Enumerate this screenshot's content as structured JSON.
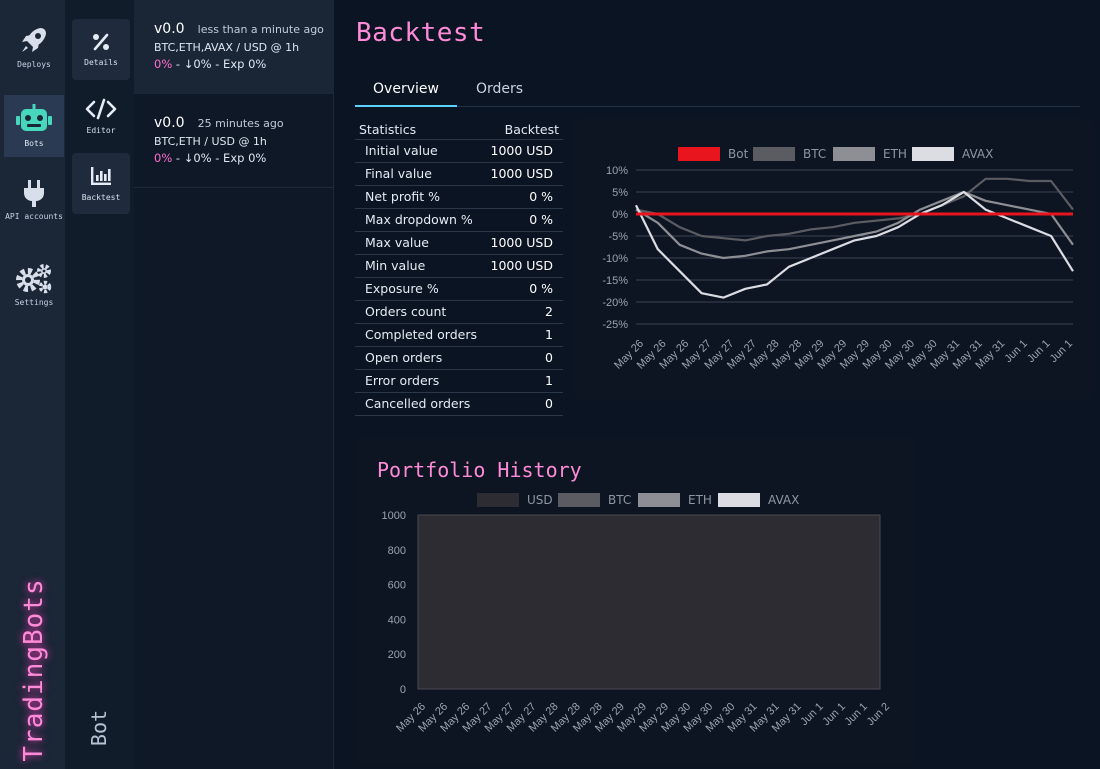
{
  "nav": {
    "items": [
      {
        "label": "Deploys",
        "icon": "rocket-icon"
      },
      {
        "label": "Bots",
        "icon": "robot-icon"
      },
      {
        "label": "API accounts",
        "icon": "plug-icon"
      },
      {
        "label": "Settings",
        "icon": "gears-icon"
      }
    ],
    "brand": "TradingBots"
  },
  "subnav": {
    "items": [
      {
        "label": "Details",
        "icon": "percent-icon"
      },
      {
        "label": "Editor",
        "icon": "code-icon"
      },
      {
        "label": "Backtest",
        "icon": "bar-chart-icon"
      }
    ],
    "section": "Bot"
  },
  "bots": [
    {
      "version": "v0.0",
      "time": "less than a minute ago",
      "pair": "BTC,ETH,AVAX / USD @ 1h",
      "profit": "0%",
      "rest": " - ↓0% - Exp 0%"
    },
    {
      "version": "v0.0",
      "time": "25 minutes ago",
      "pair": "BTC,ETH / USD @ 1h",
      "profit": "0%",
      "rest": " - ↓0% - Exp 0%"
    }
  ],
  "page": {
    "title": "Backtest",
    "tabs": [
      "Overview",
      "Orders"
    ]
  },
  "stats": {
    "headers": [
      "Statistics",
      "Backtest"
    ],
    "rows": [
      {
        "label": "Initial value",
        "value": "1000 USD"
      },
      {
        "label": "Final value",
        "value": "1000 USD"
      },
      {
        "label": "Net profit %",
        "value": "0 %"
      },
      {
        "label": "Max dropdown %",
        "value": "0 %"
      },
      {
        "label": "Max value",
        "value": "1000 USD"
      },
      {
        "label": "Min value",
        "value": "1000 USD"
      },
      {
        "label": "Exposure %",
        "value": "0 %"
      },
      {
        "label": "Orders count",
        "value": "2"
      },
      {
        "label": "Completed orders",
        "value": "1"
      },
      {
        "label": "Open orders",
        "value": "0"
      },
      {
        "label": "Error orders",
        "value": "1"
      },
      {
        "label": "Cancelled orders",
        "value": "0"
      }
    ]
  },
  "colors": {
    "accent": "#ff8ad8",
    "bot": "#e8141e",
    "btc": "#5b5c61",
    "eth": "#8e8f94",
    "avax": "#dcdde2",
    "usd": "#2e2c33"
  },
  "chart_data": [
    {
      "type": "line",
      "legend": [
        "Bot",
        "BTC",
        "ETH",
        "AVAX"
      ],
      "yticks": [
        "10%",
        "5%",
        "0%",
        "-5%",
        "-10%",
        "-15%",
        "-20%",
        "-25%"
      ],
      "ylim": [
        -25,
        10
      ],
      "xticks": [
        "May 26",
        "May 26",
        "May 26",
        "May 27",
        "May 27",
        "May 27",
        "May 28",
        "May 28",
        "May 29",
        "May 29",
        "May 29",
        "May 30",
        "May 30",
        "May 30",
        "May 31",
        "May 31",
        "May 31",
        "Jun 1",
        "Jun 1",
        "Jun 1"
      ],
      "series": [
        {
          "name": "Bot",
          "values": [
            0,
            0,
            0,
            0,
            0,
            0,
            0,
            0,
            0,
            0,
            0,
            0,
            0,
            0,
            0,
            0,
            0,
            0,
            0,
            0,
            0
          ]
        },
        {
          "name": "BTC",
          "values": [
            1,
            0,
            -3,
            -5,
            -5.5,
            -6,
            -5,
            -4.5,
            -3.5,
            -3,
            -2,
            -1.5,
            -1,
            0,
            2,
            4,
            8,
            8,
            7.5,
            7.5,
            1
          ]
        },
        {
          "name": "ETH",
          "values": [
            1,
            -2,
            -7,
            -9,
            -10,
            -9.5,
            -8.5,
            -8,
            -7,
            -6,
            -5,
            -4,
            -2,
            1,
            3,
            5,
            3,
            2,
            1,
            0,
            -7
          ]
        },
        {
          "name": "AVAX",
          "values": [
            2,
            -8,
            -13,
            -18,
            -19,
            -17,
            -16,
            -12,
            -10,
            -8,
            -6,
            -5,
            -3,
            0,
            2,
            5,
            1,
            -1,
            -3,
            -5,
            -13
          ]
        }
      ]
    },
    {
      "type": "area",
      "title": "Portfolio History",
      "legend": [
        "USD",
        "BTC",
        "ETH",
        "AVAX"
      ],
      "yticks": [
        "1000",
        "800",
        "600",
        "400",
        "200",
        "0"
      ],
      "ylim": [
        0,
        1000
      ],
      "xticks": [
        "May 26",
        "May 26",
        "May 26",
        "May 27",
        "May 27",
        "May 27",
        "May 28",
        "May 28",
        "May 28",
        "May 29",
        "May 29",
        "May 29",
        "May 30",
        "May 30",
        "May 30",
        "May 31",
        "May 31",
        "May 31",
        "Jun 1",
        "Jun 1",
        "Jun 1",
        "Jun 2"
      ],
      "series": [
        {
          "name": "USD",
          "values": [
            1000,
            1000,
            1000,
            1000,
            1000,
            1000,
            1000,
            1000,
            1000,
            1000,
            1000,
            1000,
            1000,
            1000,
            1000,
            1000,
            1000,
            1000,
            1000,
            1000,
            1000,
            1000
          ]
        },
        {
          "name": "BTC",
          "values": [
            0,
            0,
            0,
            0,
            0,
            0,
            0,
            0,
            0,
            0,
            0,
            0,
            0,
            0,
            0,
            0,
            0,
            0,
            0,
            0,
            0,
            0
          ]
        },
        {
          "name": "ETH",
          "values": [
            0,
            0,
            0,
            0,
            0,
            0,
            0,
            0,
            0,
            0,
            0,
            0,
            0,
            0,
            0,
            0,
            0,
            0,
            0,
            0,
            0,
            0
          ]
        },
        {
          "name": "AVAX",
          "values": [
            0,
            0,
            0,
            0,
            0,
            0,
            0,
            0,
            0,
            0,
            0,
            0,
            0,
            0,
            0,
            0,
            0,
            0,
            0,
            0,
            0,
            0
          ]
        }
      ]
    }
  ]
}
